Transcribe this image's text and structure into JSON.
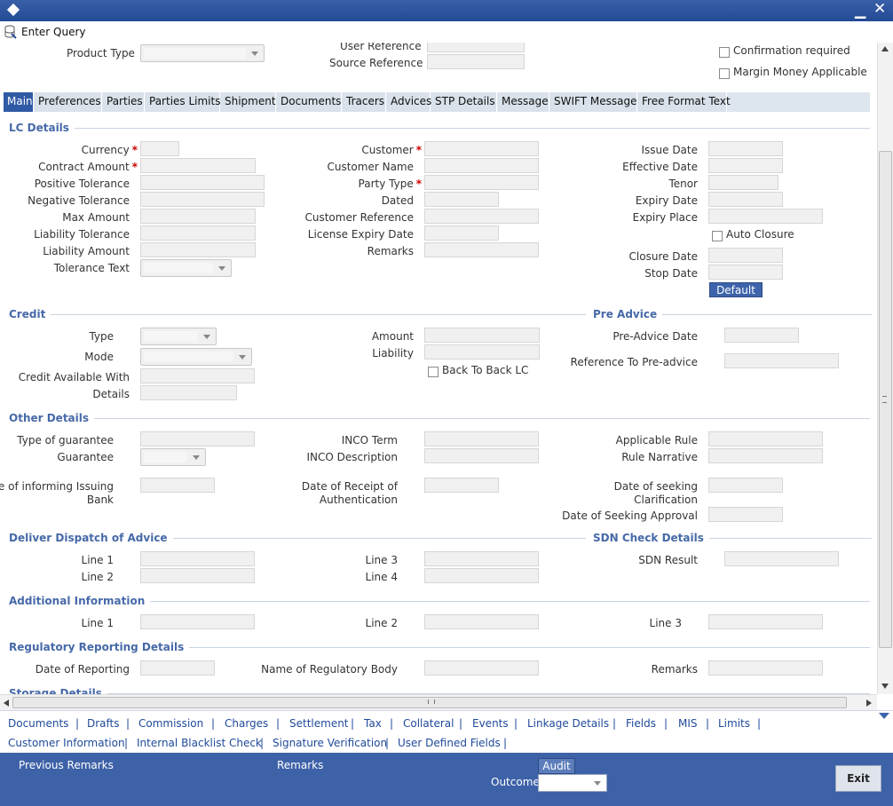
{
  "toolbar": {
    "enter_query": "Enter Query"
  },
  "header": {
    "product_type": "Product Type",
    "user_reference": "User Reference",
    "source_reference": "Source Reference",
    "confirmation_required": "Confirmation required",
    "margin_money": "Margin Money Applicable"
  },
  "tabs": [
    "Main",
    "Preferences",
    "Parties",
    "Parties Limits",
    "Shipment",
    "Documents",
    "Tracers",
    "Advices",
    "STP Details",
    "Message",
    "SWIFT Message",
    "Free Format Text"
  ],
  "lc": {
    "title": "LC Details",
    "currency": "Currency",
    "contract_amount": "Contract Amount",
    "positive_tolerance": "Positive Tolerance",
    "negative_tolerance": "Negative Tolerance",
    "max_amount": "Max Amount",
    "liability_tolerance": "Liability Tolerance",
    "liability_amount": "Liability Amount",
    "tolerance_text": "Tolerance Text",
    "customer": "Customer",
    "customer_name": "Customer Name",
    "party_type": "Party Type",
    "dated": "Dated",
    "customer_reference": "Customer Reference",
    "license_expiry_date": "License Expiry Date",
    "remarks": "Remarks",
    "issue_date": "Issue Date",
    "effective_date": "Effective Date",
    "tenor": "Tenor",
    "expiry_date": "Expiry Date",
    "expiry_place": "Expiry Place",
    "auto_closure": "Auto Closure",
    "closure_date": "Closure Date",
    "stop_date": "Stop Date",
    "default_btn": "Default"
  },
  "credit": {
    "title": "Credit",
    "type": "Type",
    "mode": "Mode",
    "available_with": "Credit Available With",
    "details": "Details",
    "amount": "Amount",
    "liability": "Liability",
    "back_to_back": "Back To Back LC"
  },
  "pre_advice": {
    "title": "Pre Advice",
    "date": "Pre-Advice Date",
    "reference": "Reference To Pre-advice"
  },
  "other": {
    "title": "Other Details",
    "type_of_guarantee": "Type of guarantee",
    "guarantee": "Guarantee",
    "date_informing_1": "Date of informing Issuing",
    "date_informing_2": "Bank",
    "inco_term": "INCO Term",
    "inco_description": "INCO Description",
    "date_receipt_1": "Date of Receipt of",
    "date_receipt_2": "Authentication",
    "applicable_rule": "Applicable Rule",
    "rule_narrative": "Rule Narrative",
    "date_seeking_1": "Date of seeking",
    "date_seeking_2": "Clarification",
    "date_seeking_approval": "Date of Seeking Approval"
  },
  "deliver": {
    "title": "Deliver Dispatch of Advice",
    "line1": "Line 1",
    "line2": "Line 2",
    "line3": "Line 3",
    "line4": "Line 4"
  },
  "sdn": {
    "title": "SDN Check Details",
    "result": "SDN Result"
  },
  "additional": {
    "title": "Additional Information",
    "line1": "Line 1",
    "line2": "Line 2",
    "line3": "Line 3"
  },
  "regulatory": {
    "title": "Regulatory Reporting Details",
    "date_of_reporting": "Date of Reporting",
    "regulatory_body": "Name of Regulatory Body",
    "remarks": "Remarks"
  },
  "storage": {
    "title": "Storage Details"
  },
  "links_row1": [
    "Documents",
    "Drafts",
    "Commission",
    "Charges",
    "Settlement",
    "Tax",
    "Collateral",
    "Events",
    "Linkage Details",
    "Fields",
    "MIS",
    "Limits"
  ],
  "links_row2": [
    "Customer Information",
    "Internal Blacklist Check",
    "Signature Verification",
    "User Defined Fields"
  ],
  "footer": {
    "previous_remarks": "Previous Remarks",
    "remarks": "Remarks",
    "audit": "Audit",
    "outcome": "Outcome",
    "exit": "Exit"
  },
  "colors": {
    "title_bar": "#2a4f99",
    "footer": "#3e62a8",
    "section_title": "#4669a8",
    "active_tab": "#2f5aa6"
  }
}
